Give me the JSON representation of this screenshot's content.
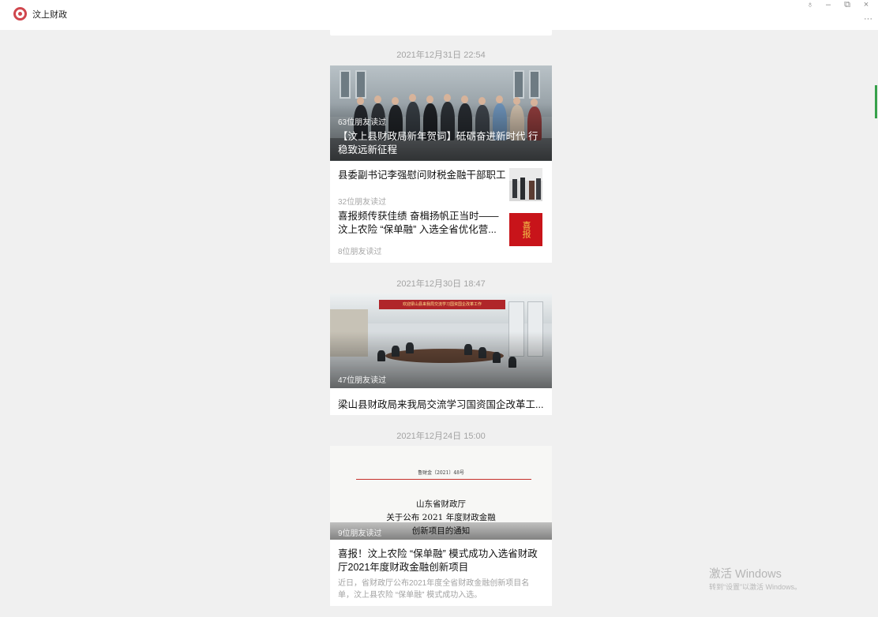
{
  "app": {
    "title": "汶上财政"
  },
  "window_controls": {
    "pin": "♁",
    "minimize": "–",
    "restore": "⧉",
    "close": "×",
    "more": "···"
  },
  "feed": [
    {
      "date": "2021年12月31日  22:54",
      "cover": {
        "read_count": "63位朋友读过",
        "title": "【汶上县财政局新年贺词】砥砺奋进新时代 行稳致远新征程"
      },
      "items": [
        {
          "title": "县委副书记李强慰问财税金融干部职工",
          "read_count": "32位朋友读过"
        },
        {
          "title": "喜报频传获佳绩 奋楫扬帆正当时——汶上农险 “保单融” 入选全省优化营...",
          "read_count": "8位朋友读过",
          "thumb_text": "喜报"
        }
      ]
    },
    {
      "date": "2021年12月30日  18:47",
      "cover": {
        "read_count": "47位朋友读过",
        "banner": "欢迎梁山县来我局交流学习国资国企改革工作"
      },
      "title": "梁山县财政局来我局交流学习国资国企改革工..."
    },
    {
      "date": "2021年12月24日  15:00",
      "cover": {
        "read_count": "9位朋友读过",
        "doc_code": "鲁财金〔2021〕48号",
        "doc_lines": [
          "山东省财政厅",
          "关于公布 2021 年度财政金融",
          "创新项目的通知"
        ]
      },
      "title": "喜报！汶上农险 “保单融” 模式成功入选省财政厅2021年度财政金融创新项目",
      "desc": "近日，省财政厅公布2021年度全省财政金融创新项目名单，汶上县农险 “保单融” 模式成功入选。"
    }
  ],
  "watermark": {
    "title": "激活 Windows",
    "subtitle": "转到“设置”以激活 Windows。"
  },
  "colors": {
    "accent": "#d0464d",
    "background": "#f0f0f0",
    "muted": "#a3a3a3"
  }
}
